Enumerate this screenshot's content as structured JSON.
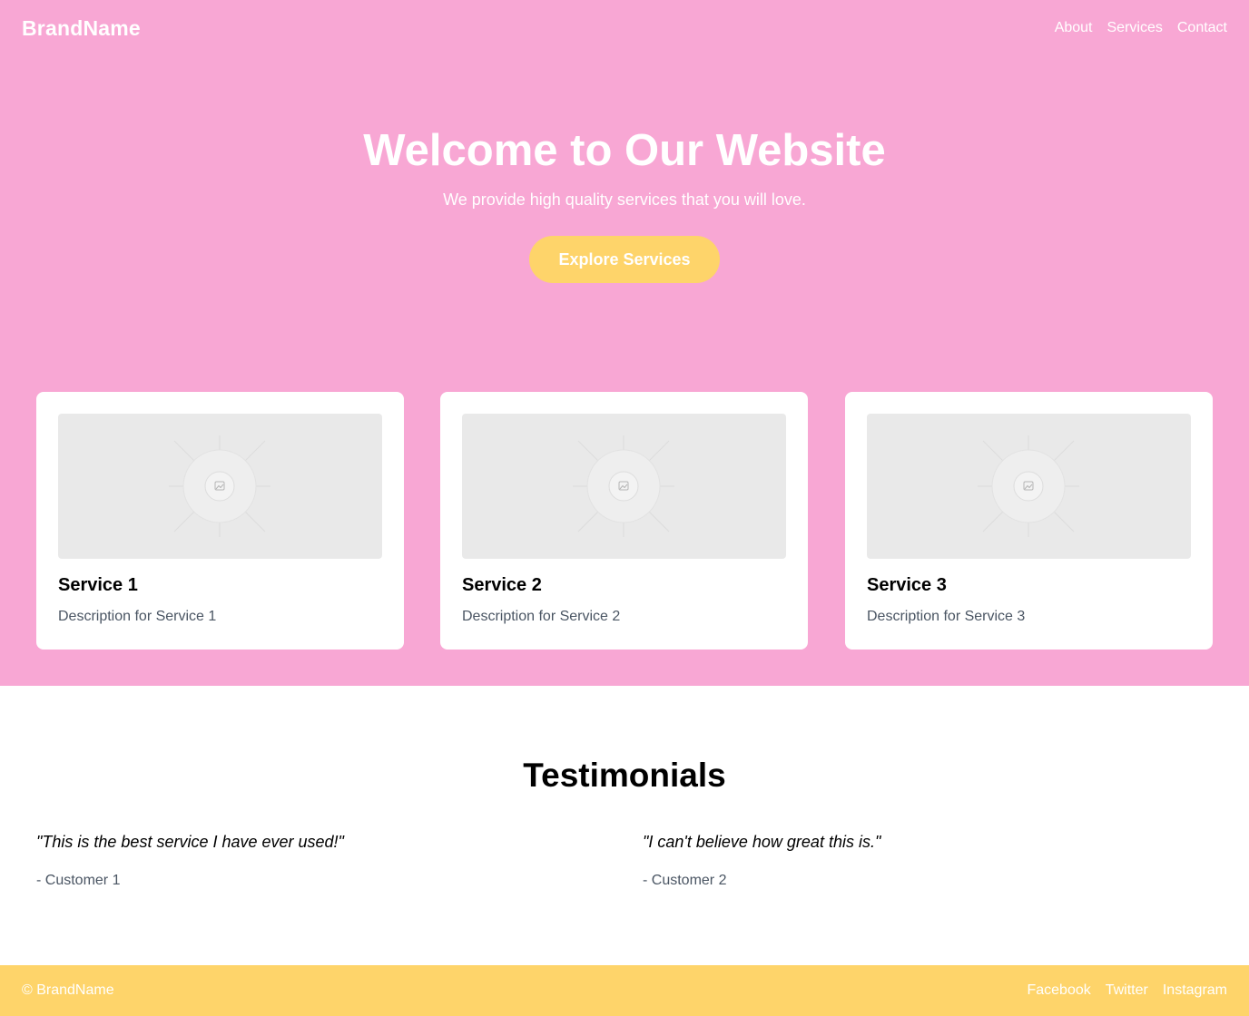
{
  "header": {
    "brand": "BrandName",
    "nav": [
      "About",
      "Services",
      "Contact"
    ]
  },
  "hero": {
    "title": "Welcome to Our Website",
    "subtitle": "We provide high quality services that you will love.",
    "cta_label": "Explore Services"
  },
  "services": [
    {
      "title": "Service 1",
      "description": "Description for Service 1",
      "image_icon": "image-placeholder-icon"
    },
    {
      "title": "Service 2",
      "description": "Description for Service 2",
      "image_icon": "image-placeholder-icon"
    },
    {
      "title": "Service 3",
      "description": "Description for Service 3",
      "image_icon": "image-placeholder-icon"
    }
  ],
  "testimonials": {
    "title": "Testimonials",
    "items": [
      {
        "quote": "\"This is the best service I have ever used!\"",
        "author": "- Customer 1"
      },
      {
        "quote": "\"I can't believe how great this is.\"",
        "author": "- Customer 2"
      }
    ]
  },
  "footer": {
    "copyright": "© BrandName",
    "social": [
      "Facebook",
      "Twitter",
      "Instagram"
    ]
  },
  "colors": {
    "primary_pink": "#f8a7d4",
    "accent_yellow": "#fed46a",
    "text_muted": "#4a5563"
  }
}
